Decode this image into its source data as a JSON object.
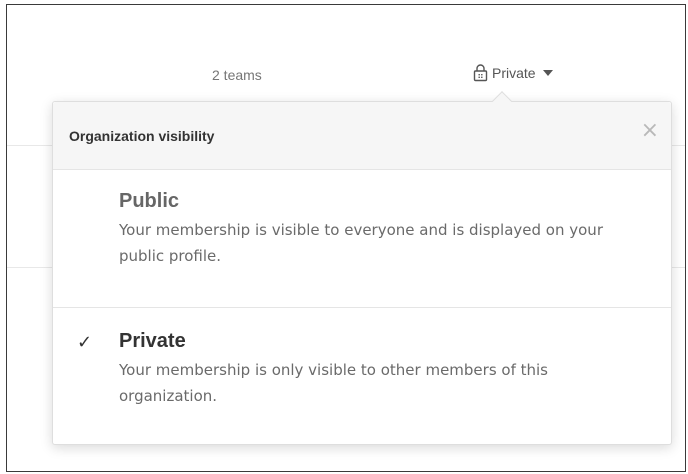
{
  "header": {
    "teams_count": "2 teams",
    "visibility_label": "Private"
  },
  "popover": {
    "title": "Organization visibility",
    "close_glyph": "×",
    "options": [
      {
        "title": "Public",
        "description": "Your membership is visible to everyone and is displayed on your public profile.",
        "selected": false
      },
      {
        "title": "Private",
        "description": "Your membership is only visible to other members of this organization.",
        "selected": true
      }
    ],
    "check_glyph": "✓"
  },
  "icons": [
    "lock-icon",
    "caret-down-icon",
    "close-icon",
    "checkmark-icon"
  ],
  "colors": {
    "header_bg": "#f6f6f6",
    "border": "#dedede",
    "text": "#333333",
    "muted_text": "#6a6a6a"
  }
}
